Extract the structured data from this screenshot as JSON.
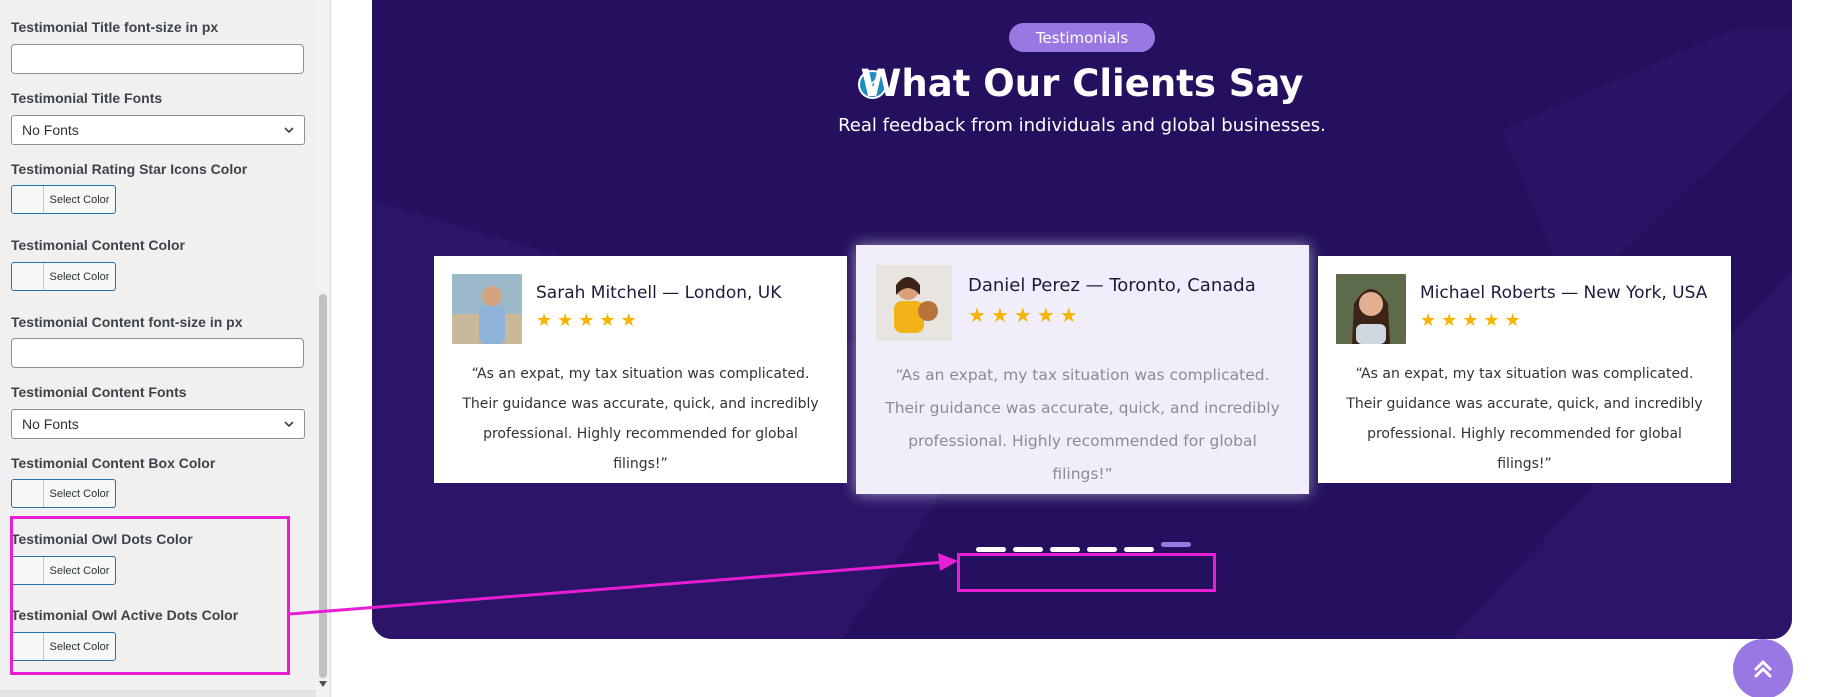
{
  "panel": {
    "fields": [
      {
        "label": "Testimonial Title font-size in px",
        "type": "text",
        "value": ""
      },
      {
        "label": "Testimonial Title Fonts",
        "type": "select",
        "value": "No Fonts"
      },
      {
        "label": "Testimonial Rating Star Icons Color",
        "type": "color",
        "button": "Select Color"
      },
      {
        "label": "Testimonial Content Color",
        "type": "color",
        "button": "Select Color"
      },
      {
        "label": "Testimonial Content font-size in px",
        "type": "text",
        "value": ""
      },
      {
        "label": "Testimonial Content Fonts",
        "type": "select",
        "value": "No Fonts"
      },
      {
        "label": "Testimonial Content Box Color",
        "type": "color",
        "button": "Select Color"
      },
      {
        "label": "Testimonial Owl Dots Color",
        "type": "color",
        "button": "Select Color"
      },
      {
        "label": "Testimonial Owl Active Dots Color",
        "type": "color",
        "button": "Select Color"
      }
    ]
  },
  "section": {
    "badge": "Testimonials",
    "title": "What Our Clients Say",
    "subtitle": "Real feedback from individuals and global businesses.",
    "cards": [
      {
        "name": "Sarah Mitchell — London, UK",
        "rating": 5,
        "quote": "“As an expat, my tax situation was complicated. Their guidance was accurate, quick, and incredibly professional. Highly recommended for global filings!”"
      },
      {
        "name": "Daniel Perez — Toronto, Canada",
        "rating": 5,
        "quote": "“As an expat, my tax situation was complicated. Their guidance was accurate, quick, and incredibly professional. Highly recommended for global filings!”"
      },
      {
        "name": "Michael Roberts — New York, USA",
        "rating": 5,
        "quote": "“As an expat, my tax situation was complicated. Their guidance was accurate, quick, and incredibly professional. Highly recommended for global filings!”"
      }
    ],
    "dots_count": 6,
    "active_dot": 6
  },
  "colors": {
    "section_bg": "#25105f",
    "accent": "#9a78e4",
    "star": "#f5b400",
    "highlight": "#e91ed4"
  }
}
